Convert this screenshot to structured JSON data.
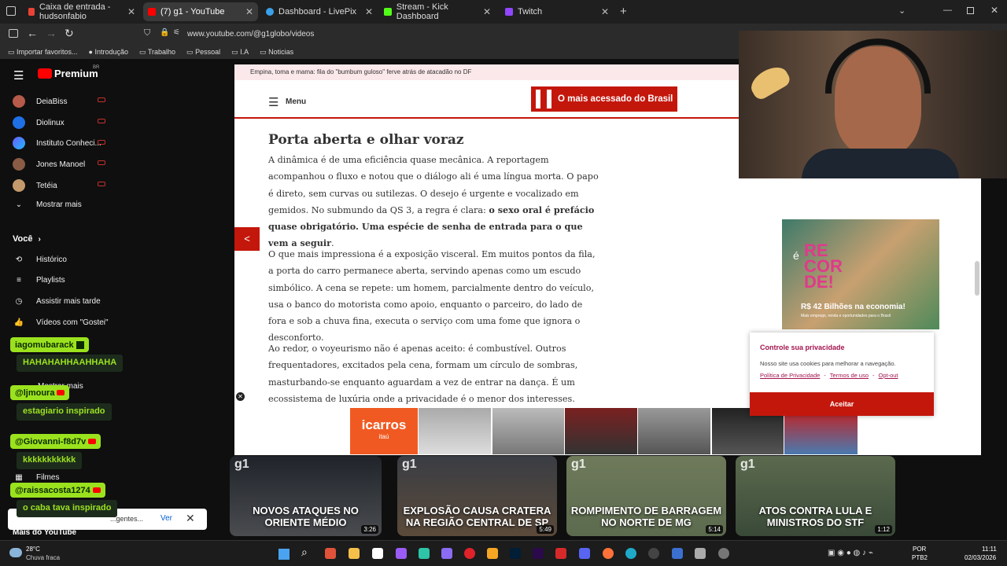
{
  "tabs": [
    {
      "label": "Caixa de entrada - hudsonfabio",
      "color": "#ea4335"
    },
    {
      "label": "(7) g1 - YouTube",
      "color": "#ff0000"
    },
    {
      "label": "Dashboard - LivePix",
      "color": "#3aa0e8"
    },
    {
      "label": "Stream - Kick Dashboard",
      "color": "#53fc18"
    },
    {
      "label": "Twitch",
      "color": "#9146ff"
    }
  ],
  "address": {
    "url": "www.youtube.com/@g1globo/videos"
  },
  "bookmarks": [
    "Importar favoritos...",
    "Introdução",
    "Trabalho",
    "Pessoal",
    "I.A",
    "Noticias"
  ],
  "youtube": {
    "logo": "Premium",
    "region": "BR",
    "subscriptions": [
      "DeiaBiss",
      "Diolinux",
      "Instituto Conheci...",
      "Jones Manoel",
      "Tetéia"
    ],
    "show_more": "Mostrar mais",
    "you_header": "Você",
    "you_items": [
      "Histórico",
      "Playlists",
      "Assistir mais tarde",
      "Vídeos com \"Gostei\""
    ],
    "movies": "Filmes",
    "more_label": "Mais do YouTube",
    "more_partial": "Mostrar mais"
  },
  "article": {
    "announcement": "Empina, toma e mama: fila do \"bumbum guloso\" ferve atrás de atacadão no DF",
    "menu_label": "Menu",
    "banner": "O mais acessado do Brasil",
    "heading": "Porta aberta e olhar voraz",
    "p1": "A dinâmica é de uma eficiência quase mecânica. A reportagem acompanhou o fluxo e notou que o diálogo ali é uma língua morta. O papo é direto, sem curvas ou sutilezas. O desejo é urgente e vocalizado em gemidos. No submundo da QS 3, a regra é clara: ",
    "p1_bold": "o sexo oral é prefácio quase obrigatório. Uma espécie de senha de entrada para o que vem a seguir",
    "p1_end": ".",
    "p2": "O que mais impressiona é a exposição visceral. Em muitos pontos da fila, a porta do carro permanece aberta, servindo apenas como um escudo simbólico. A cena se repete: um homem, parcialmente dentro do veículo, usa o banco do motorista como apoio, enquanto o parceiro, do lado de fora e sob a chuva fina, executa o serviço com uma fome que ignora o desconforto.",
    "p3": "Ao redor, o voyeurismo não é apenas aceito: é combustível. Outros frequentadores, excitados pela cena, formam um círculo de sombras, masturbando-se enquanto aguardam a vez de entrar na dança. É um ecossistema de luxúria onde a privacidade é o menor dos interesses."
  },
  "ad": {
    "prefix": "é",
    "big": "RE COR DE!",
    "amount": "R$ 42 Bilhões na economia!",
    "sub": "Mais emprego, renda e oportunidades para o Brasil"
  },
  "privacy": {
    "title": "Controle sua privacidade",
    "text": "Nosso site usa cookies para melhorar a navegação.",
    "links": [
      "Política de Privacidade",
      "Termos de uso",
      "Opt-out"
    ],
    "accept": "Aceitar"
  },
  "cars_ad": {
    "brand": "icarros",
    "sub": "itaú"
  },
  "thumbs": [
    {
      "caption": "NOVOS ATAQUES NO ORIENTE MÉDIO",
      "duration": "3:26"
    },
    {
      "caption": "EXPLOSÃO CAUSA CRATERA NA REGIÃO CENTRAL DE SP",
      "duration": "5:49"
    },
    {
      "caption": "ROMPIMENTO DE BARRAGEM NO NORTE DE MG",
      "duration": "5:14"
    },
    {
      "caption": "ATOS CONTRA LULA E MINISTROS DO STF",
      "duration": "1:12"
    }
  ],
  "chat": [
    {
      "user": "iagomubarack",
      "msg": "HAHAHAHHAAHHAHA"
    },
    {
      "user": "@ljmoura",
      "msg": "estagiario inspirado"
    },
    {
      "user": "@Giovanni-f8d7v",
      "msg": "kkkkkkkkkkk"
    },
    {
      "user": "@raissacosta1274",
      "msg": "o caba tava inspirado"
    }
  ],
  "notification": {
    "text": "...gentes...",
    "action": "Ver"
  },
  "taskbar": {
    "weather_temp": "28°C",
    "weather_desc": "Chuva fraca",
    "lang": "POR",
    "layout": "PTB2",
    "time": "11:11",
    "date": "02/03/2026"
  }
}
